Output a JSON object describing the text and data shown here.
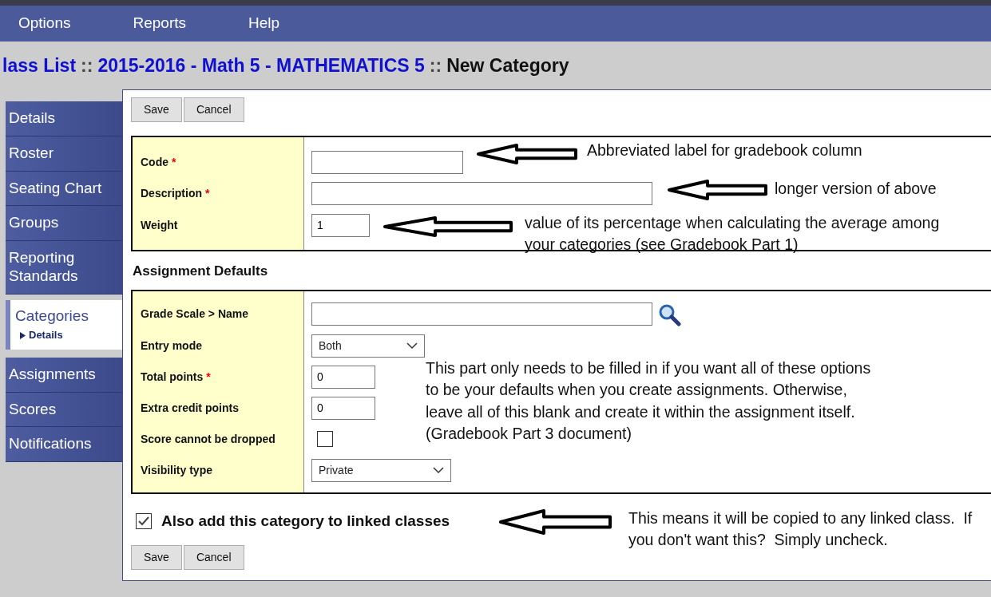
{
  "menu": [
    "Options",
    "Reports",
    "Help"
  ],
  "required_marker": "*",
  "breadcrumb": [
    {
      "kind": "link",
      "text": "lass List"
    },
    {
      "kind": "sep",
      "text": "::"
    },
    {
      "kind": "link",
      "text": "2015-2016 - Math 5 - MATHEMATICS 5"
    },
    {
      "kind": "sep",
      "text": "::"
    },
    {
      "kind": "current",
      "text": "New Category"
    }
  ],
  "sidebar": [
    {
      "label": "Details",
      "selected": false
    },
    {
      "label": "Roster",
      "selected": false
    },
    {
      "label": "Seating Chart",
      "selected": false
    },
    {
      "label": "Groups",
      "selected": false
    },
    {
      "label": "Reporting Standards",
      "selected": false
    },
    {
      "label": "Categories",
      "selected": true,
      "children": [
        {
          "label": "Details"
        }
      ]
    },
    {
      "label": "Assignments",
      "selected": false
    },
    {
      "label": "Scores",
      "selected": false
    },
    {
      "label": "Notifications",
      "selected": false
    }
  ],
  "top_buttons": [
    "Save",
    "Cancel"
  ],
  "category_fields": [
    {
      "label": "Code",
      "required": true,
      "kind": "text"
    },
    {
      "label": "Description",
      "required": true,
      "kind": "text"
    },
    {
      "label": "Weight",
      "required": false,
      "kind": "text",
      "value": "1"
    }
  ],
  "section_title": "Assignment Defaults",
  "default_fields": [
    {
      "label": "Grade Scale > Name",
      "required": false,
      "kind": "lookup"
    },
    {
      "label": "Entry mode",
      "required": false,
      "kind": "select",
      "value": "Both"
    },
    {
      "label": "Total points",
      "required": true,
      "kind": "text",
      "value": "0"
    },
    {
      "label": "Extra credit points",
      "required": false,
      "kind": "text",
      "value": "0"
    },
    {
      "label": "Score cannot be dropped",
      "required": false,
      "kind": "checkbox",
      "checked": false
    },
    {
      "label": "Visibility type",
      "required": false,
      "kind": "select",
      "value": "Private"
    }
  ],
  "linked": {
    "label": "Also add this category to linked classes",
    "checked": true
  },
  "bottom_buttons": [
    "Save",
    "Cancel"
  ],
  "annotations": [
    {
      "text": "Abbreviated label for gradebook column",
      "arrow": true
    },
    {
      "text": "longer version of above",
      "arrow": true
    },
    {
      "text": "value of its percentage when calculating the average among your categories (see Gradebook Part 1)",
      "arrow": true
    },
    {
      "text": "This part only needs to be filled in if you want all of these options to be your defaults when you create assignments. Otherwise, leave all of this blank and create it within the assignment itself.  (Gradebook Part 3 document)",
      "arrow": false
    },
    {
      "text": "This means it will be copied to any linked class.  If you don't want this?  Simply uncheck.",
      "arrow": true
    }
  ]
}
